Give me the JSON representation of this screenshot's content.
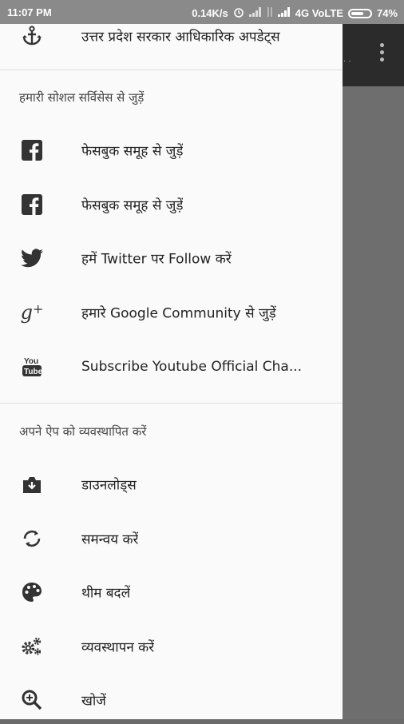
{
  "status_bar": {
    "time": "11:07 PM",
    "speed": "0.14K/s",
    "network": "4G VoLTE",
    "battery": "74%",
    "battery_level": 0.74
  },
  "drawer": {
    "top_item": {
      "label": "उत्तर प्रदेश सरकार आधिकारिक अपडेट्स",
      "icon": "anchor-icon"
    },
    "social_header": "हमारी सोशल सर्विसेस से जुड़ें",
    "social_items": [
      {
        "label": "फेसबुक समूह से जुड़ें",
        "icon": "facebook-icon"
      },
      {
        "label": "फेसबुक समूह से जुड़ें",
        "icon": "facebook-icon"
      },
      {
        "label": "हमें Twitter पर Follow करें",
        "icon": "twitter-icon"
      },
      {
        "label": "हमारे Google Community से जुड़ें",
        "icon": "google-plus-icon"
      },
      {
        "label": "Subscribe Youtube Official Cha...",
        "icon": "youtube-icon"
      }
    ],
    "app_header": "अपने ऐप को व्यवस्थापित करें",
    "app_items": [
      {
        "label": "डाउनलोड्स",
        "icon": "downloads-icon"
      },
      {
        "label": "समन्वय करें",
        "icon": "sync-icon"
      },
      {
        "label": "थीम बदलें",
        "icon": "palette-icon"
      },
      {
        "label": "व्यवस्थापन करें",
        "icon": "settings-icon"
      },
      {
        "label": "खोजें",
        "icon": "search-icon"
      }
    ]
  }
}
